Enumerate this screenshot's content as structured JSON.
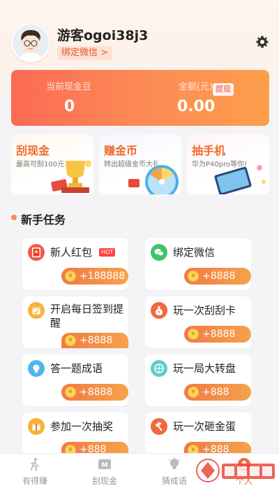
{
  "profile": {
    "username": "游客ogoi38j3",
    "bind_wechat": "绑定微信 >"
  },
  "balance": {
    "gold_label": "当前现金豆",
    "gold_value": "0",
    "amount_label": "金额(元)",
    "amount_value": "0.00",
    "withdraw": "提现"
  },
  "features": [
    {
      "title": "刮现金",
      "subtitle": "最高可刮100元",
      "color": "#f06a2a"
    },
    {
      "title": "赚金币",
      "subtitle": "转出超级金币大礼",
      "color": "#f06a2a"
    },
    {
      "title": "抽手机",
      "subtitle": "华为P40pro等你!",
      "color": "#f06a2a"
    }
  ],
  "section": {
    "title": "新手任务"
  },
  "tasks": [
    {
      "name": "新人红包",
      "reward": "+188888",
      "hot": "HOT",
      "icon": "red-envelope-icon"
    },
    {
      "name": "绑定微信",
      "reward": "+8888",
      "icon": "wechat-icon"
    },
    {
      "name": "开启每日签到提醒",
      "reward": "+8888",
      "icon": "calendar-icon"
    },
    {
      "name": "玩一次刮刮卡",
      "reward": "+8888",
      "icon": "money-bag-icon"
    },
    {
      "name": "答一题成语",
      "reward": "+8888",
      "icon": "lightbulb-icon"
    },
    {
      "name": "玩一局大转盘",
      "reward": "+888",
      "icon": "wheel-icon"
    },
    {
      "name": "参加一次抽奖",
      "reward": "+888",
      "icon": "gift-icon"
    },
    {
      "name": "玩一次砸金蛋",
      "reward": "+888",
      "icon": "hammer-icon"
    }
  ],
  "coin_symbol": "¥",
  "nav": [
    {
      "label": "有得赚",
      "icon": "walk-icon"
    },
    {
      "label": "刮现金",
      "icon": "scratch-icon"
    },
    {
      "label": "猜成语",
      "icon": "bulb-icon"
    },
    {
      "label": "个人",
      "icon": "user-icon",
      "active": true
    }
  ],
  "colors": {
    "accent": "#f06a3c",
    "card_gradient_start": "#fb6a55",
    "card_gradient_end": "#fe9e4c"
  }
}
